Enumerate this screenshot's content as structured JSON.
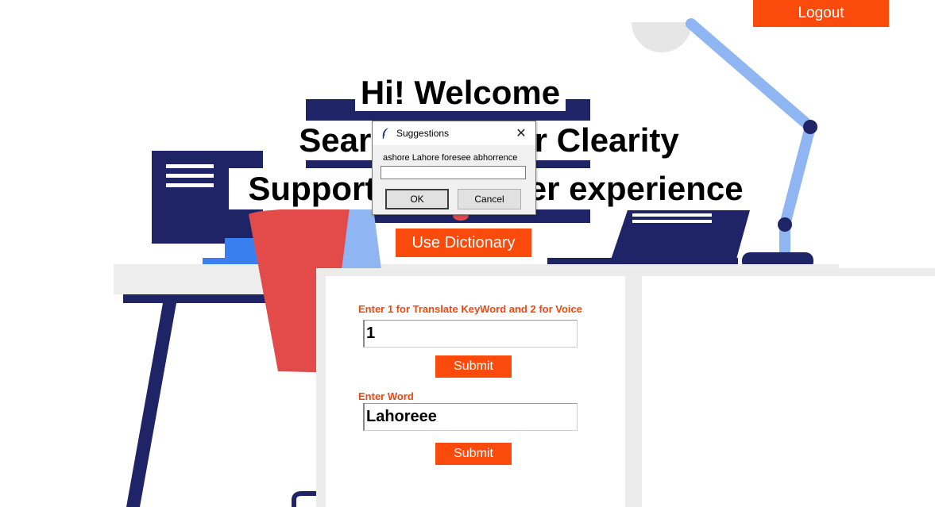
{
  "header": {
    "logout_label": "Logout"
  },
  "welcome": {
    "line1": "Hi! Welcome",
    "line2": "Search Here for Clearity",
    "line3": "Support for a better experience"
  },
  "actions": {
    "use_dictionary_label": "Use Dictionary"
  },
  "dialog": {
    "title": "Suggestions",
    "message": "ashore Lahore foresee abhorrence",
    "input_value": "",
    "ok_label": "OK",
    "cancel_label": "Cancel",
    "icon": "feather-icon"
  },
  "form": {
    "mode_label": "Enter 1 for Translate KeyWord and 2 for Voice",
    "mode_value": "1",
    "submit1_label": "Submit",
    "word_label": "Enter Word",
    "word_value": "Lahoreee",
    "submit2_label": "Submit"
  },
  "colors": {
    "accent": "#fa4a0c",
    "label": "#ea4915",
    "navy": "#1e2466",
    "lamp_blue": "#8fb6f2",
    "chair_red": "#e34b4b",
    "screen_blue": "#3a7ff0"
  }
}
